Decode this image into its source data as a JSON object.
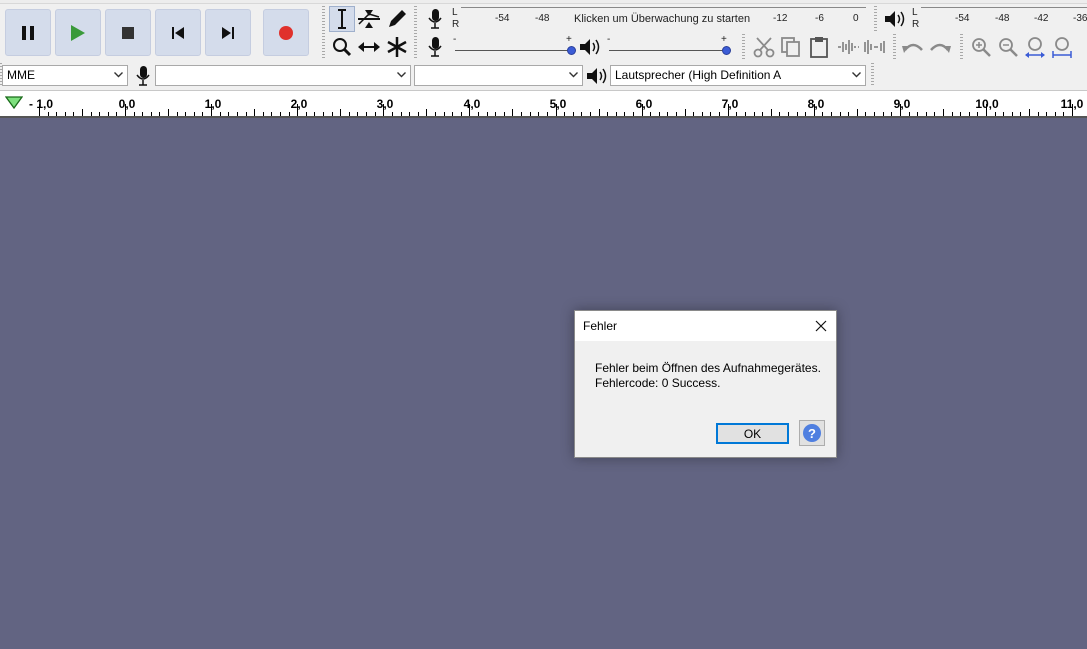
{
  "transport": {
    "pause": "pause-icon",
    "play": "play-icon",
    "stop": "stop-icon",
    "skip_start": "skip-to-start-icon",
    "skip_end": "skip-to-end-icon",
    "record": "record-icon",
    "record_color": "#e0312c",
    "play_color": "#3a9a3a"
  },
  "recording_meter": {
    "l": "L",
    "r": "R",
    "ticks": [
      "-54",
      "-48",
      "-12",
      "-6",
      "0"
    ],
    "prompt": "Klicken um Überwachung zu starten"
  },
  "playback_meter": {
    "l": "L",
    "r": "R",
    "ticks": [
      "-54",
      "-48",
      "-42",
      "-36"
    ]
  },
  "mixer": {
    "minus": "-",
    "plus": "+"
  },
  "device": {
    "host": "MME",
    "recording_device": "",
    "recording_channels": "",
    "playback_device": "Lautsprecher (High Definition A"
  },
  "ruler": {
    "labels": [
      "- 1,0",
      "0,0",
      "1,0",
      "2,0",
      "3,0",
      "4,0",
      "5,0",
      "6,0",
      "7,0",
      "8,0",
      "9,0",
      "10,0",
      "11,0"
    ]
  },
  "dialog": {
    "title": "Fehler",
    "line1": "Fehler beim Öffnen des Aufnahmegerätes.",
    "line2": "Fehlercode: 0 Success.",
    "ok_label": "OK",
    "help": "?"
  },
  "colors": {
    "workspace": "#626482",
    "toolbar": "#f0f0f0",
    "accent": "#0078d7",
    "help": "#4f7fe0"
  }
}
